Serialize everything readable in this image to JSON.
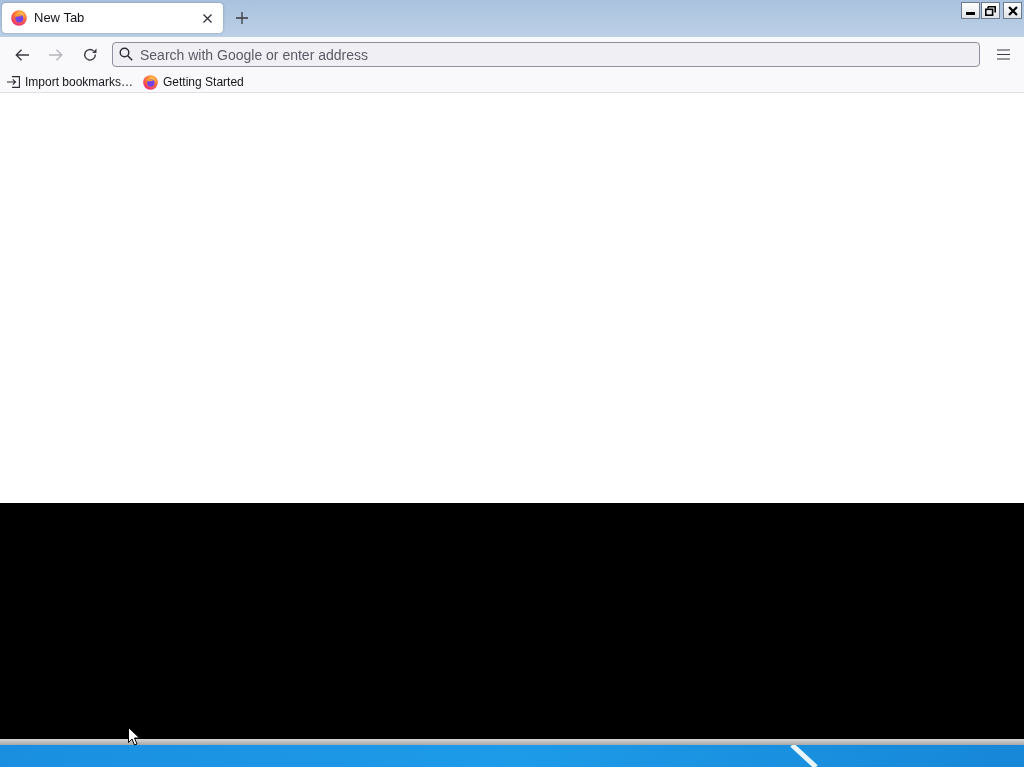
{
  "tabs": [
    {
      "label": "New Tab",
      "selected": true
    }
  ],
  "nav_buttons": [
    {
      "kind": "back",
      "disabled": false
    },
    {
      "kind": "forward",
      "disabled": true
    },
    {
      "kind": "reload",
      "disabled": false
    }
  ],
  "address_bar": {
    "placeholder": "Search with Google or enter address"
  },
  "bookmarks": [
    {
      "kind": "import",
      "label": "Import bookmarks…"
    },
    {
      "kind": "logo",
      "label": "Getting Started"
    }
  ]
}
